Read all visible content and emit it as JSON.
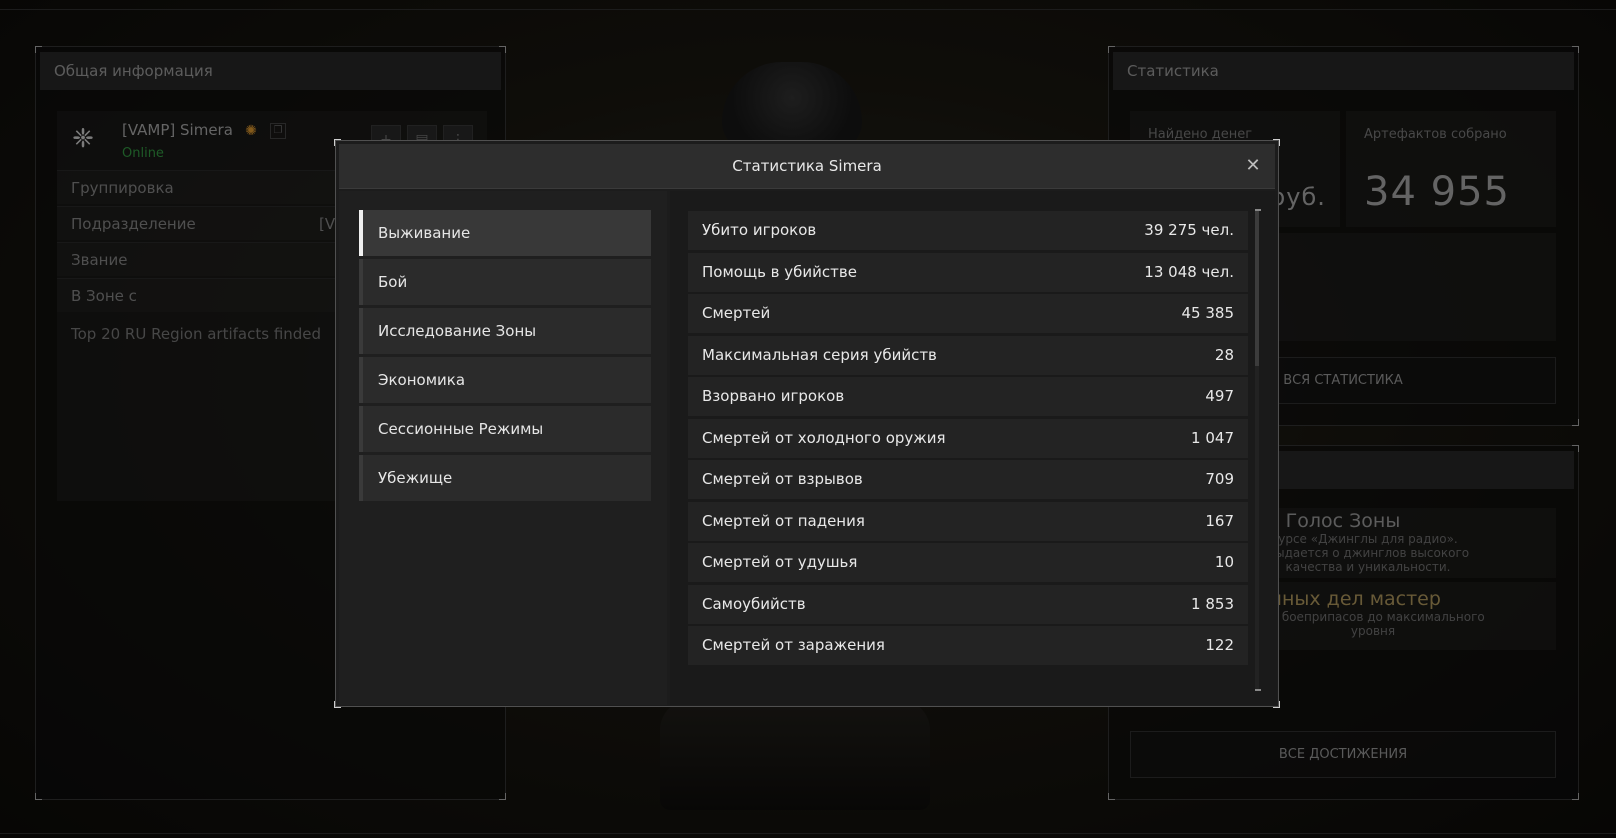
{
  "left_panel": {
    "title": "Общая информация",
    "player_name": "[VAMP] Simera",
    "status": "Online",
    "rows": [
      {
        "label": "Группировка",
        "value": ""
      },
      {
        "label": "Подразделение",
        "value": "[V"
      },
      {
        "label": "Звание",
        "value": ""
      },
      {
        "label": "В Зоне с",
        "value": ""
      }
    ],
    "bio": "Top 20 RU Region artifacts finded"
  },
  "right_panel": {
    "title": "Статистика",
    "money_label": "Найдено денег",
    "money_value": "руб.",
    "artifacts_label": "Артефактов собрано",
    "artifacts_value": "34 955",
    "all_stats_button": "ВСЯ СТАТИСТИКА",
    "achievements": [
      {
        "title": "Голос Зоны",
        "desc": "урсе «Джинглы для радио». Выдается о джинглов высокого качества и уникальности."
      },
      {
        "title": "линных дел мастер",
        "desc": "ык боеприпасов до максимального уровня"
      }
    ],
    "all_achievements_button": "ВСЕ ДОСТИЖЕНИЯ"
  },
  "modal": {
    "title": "Статистика Simera",
    "close_symbol": "✕",
    "categories": [
      {
        "label": "Выживание",
        "active": true
      },
      {
        "label": "Бой",
        "active": false
      },
      {
        "label": "Исследование Зоны",
        "active": false
      },
      {
        "label": "Экономика",
        "active": false
      },
      {
        "label": "Сессионные Режимы",
        "active": false
      },
      {
        "label": "Убежище",
        "active": false
      }
    ],
    "stats": [
      {
        "name": "Убито игроков",
        "value": "39 275 чел."
      },
      {
        "name": "Помощь в убийстве",
        "value": "13 048 чел."
      },
      {
        "name": "Смертей",
        "value": "45 385"
      },
      {
        "name": "Максимальная серия убийств",
        "value": "28"
      },
      {
        "name": "Взорвано игроков",
        "value": "497"
      },
      {
        "name": "Смертей от холодного оружия",
        "value": "1 047"
      },
      {
        "name": "Смертей от взрывов",
        "value": "709"
      },
      {
        "name": "Смертей от падения",
        "value": "167"
      },
      {
        "name": "Смертей от удушья",
        "value": "10"
      },
      {
        "name": "Самоубийств",
        "value": "1 853"
      },
      {
        "name": "Смертей от заражения",
        "value": "122"
      }
    ]
  },
  "icons": {
    "emblem": "emblem-icon",
    "badge": "clan-badge-icon",
    "copy": "copy-icon",
    "add_friend": "add-friend-icon",
    "message": "message-icon",
    "more": "more-vertical-icon",
    "close": "close-icon"
  },
  "colors": {
    "online": "#2e8b3c",
    "badge": "#c98a2a",
    "active_nav_border": "#f0f0f0"
  }
}
